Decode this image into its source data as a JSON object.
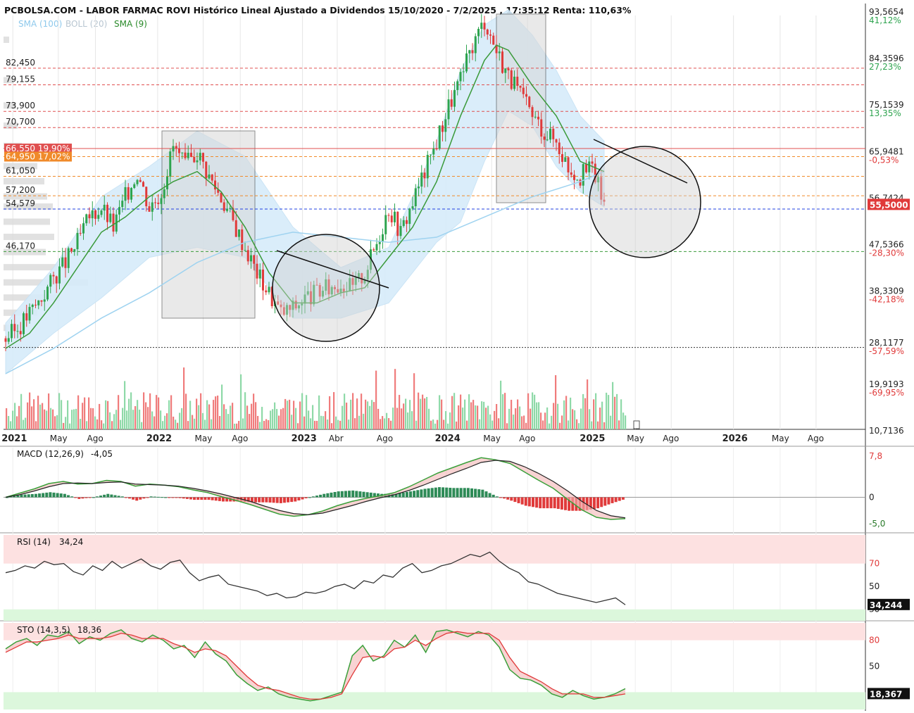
{
  "header": {
    "title": "PCBOLSA.COM - LABOR FARMAC ROVI Histórico Lineal Ajustado a Dividendos 15/10/2020 - 7/2/2025 , 17:35:12 Renta: 110,63%",
    "legend": [
      {
        "label": "SMA (100)",
        "color": "#9fd3f0"
      },
      {
        "label": "BOLL (20)",
        "color": "#cfd8df"
      },
      {
        "label": "SMA (9)",
        "color": "#2a8a2a"
      }
    ]
  },
  "colors": {
    "up": "#2ea44f",
    "down": "#e03a3a",
    "boll_fill": "#d6ecfa",
    "sma100": "#9fd3f0",
    "sma9": "#3a9a3a",
    "vol_up": "#8fd9a8",
    "vol_down": "#f07c7c"
  },
  "price_axis": {
    "ticks": [
      {
        "value": 93.5654,
        "label": "93,5654",
        "pct": "41,12%",
        "pct_color": "#2ea44f"
      },
      {
        "value": 84.3596,
        "label": "84,3596",
        "pct": "27,23%",
        "pct_color": "#2ea44f"
      },
      {
        "value": 75.1539,
        "label": "75,1539",
        "pct": "13,35%",
        "pct_color": "#2ea44f"
      },
      {
        "value": 65.9481,
        "label": "65,9481",
        "pct": "-0,53%",
        "pct_color": "#e03a3a"
      },
      {
        "value": 56.7424,
        "label": "56,7424",
        "pct": "",
        "pct_color": "#e03a3a"
      },
      {
        "value": 47.5366,
        "label": "47,5366",
        "pct": "-28,30%",
        "pct_color": "#e03a3a"
      },
      {
        "value": 38.3309,
        "label": "38,3309",
        "pct": "-42,18%",
        "pct_color": "#e03a3a"
      },
      {
        "value": 28.1177,
        "label": "28,1177",
        "pct": "-57,59%",
        "pct_color": "#e03a3a"
      },
      {
        "value": 19.9193,
        "label": "19,9193",
        "pct": "-69,95%",
        "pct_color": "#e03a3a"
      },
      {
        "value": 10.7136,
        "label": "10,7136",
        "pct": "",
        "pct_color": "#e03a3a"
      }
    ],
    "last_price": "55,5000"
  },
  "levels": [
    {
      "value": 82.45,
      "label": "82,450",
      "color": "#e05050",
      "style": "dash"
    },
    {
      "value": 79.155,
      "label": "79,155",
      "color": "#e05050",
      "style": "dash"
    },
    {
      "value": 73.9,
      "label": "73,900",
      "color": "#e05050",
      "style": "dash"
    },
    {
      "value": 70.7,
      "label": "70,700",
      "color": "#e05050",
      "style": "dash"
    },
    {
      "value": 66.55,
      "label": "66,550  19,90%",
      "color": "#e05050",
      "style": "solid",
      "boxed": true
    },
    {
      "value": 64.95,
      "label": "64,950  17,02%",
      "color": "#f08a2a",
      "style": "dash",
      "boxed": true
    },
    {
      "value": 61.05,
      "label": "61,050",
      "color": "#f08a2a",
      "style": "dash"
    },
    {
      "value": 57.2,
      "label": "57,200",
      "color": "#f08a2a",
      "style": "dash"
    },
    {
      "value": 54.579,
      "label": "54,579",
      "color": "#2040e0",
      "style": "dash"
    },
    {
      "value": 46.17,
      "label": "46,170",
      "color": "#3a9a3a",
      "style": "dash"
    }
  ],
  "x_axis": {
    "labels": [
      {
        "t": 0.6,
        "text": "2021",
        "year": true
      },
      {
        "t": 4.4,
        "text": "May",
        "year": false
      },
      {
        "t": 7.5,
        "text": "Ago",
        "year": false
      },
      {
        "t": 12.7,
        "text": "2022",
        "year": true
      },
      {
        "t": 16.5,
        "text": "May",
        "year": false
      },
      {
        "t": 19.6,
        "text": "Ago",
        "year": false
      },
      {
        "t": 24.8,
        "text": "2023",
        "year": true
      },
      {
        "t": 27.7,
        "text": "Abr",
        "year": false
      },
      {
        "t": 31.7,
        "text": "Ago",
        "year": false
      },
      {
        "t": 36.8,
        "text": "2024",
        "year": true
      },
      {
        "t": 40.6,
        "text": "May",
        "year": false
      },
      {
        "t": 43.6,
        "text": "Ago",
        "year": false
      },
      {
        "t": 48.9,
        "text": "2025",
        "year": true
      },
      {
        "t": 52.6,
        "text": "May",
        "year": false
      },
      {
        "t": 55.6,
        "text": "Ago",
        "year": false
      },
      {
        "t": 60.8,
        "text": "2026",
        "year": true
      },
      {
        "t": 64.7,
        "text": "May",
        "year": false
      },
      {
        "t": 67.7,
        "text": "Ago",
        "year": false
      }
    ]
  },
  "chart_data": [
    {
      "type": "line",
      "title": "PCBOLSA.COM - LABOR FARMAC ROVI Histórico Lineal Ajustado a Dividendos 15/10/2020 - 7/2/2025",
      "x_unit": "months since Oct 2020",
      "ylim": [
        10.7136,
        93.5654
      ],
      "series": [
        {
          "name": "price",
          "points": [
            [
              0,
              29
            ],
            [
              1,
              31
            ],
            [
              2,
              34
            ],
            [
              3,
              37
            ],
            [
              4,
              41
            ],
            [
              5,
              44
            ],
            [
              6,
              48
            ],
            [
              7,
              53
            ],
            [
              8,
              55
            ],
            [
              9,
              51
            ],
            [
              10,
              57
            ],
            [
              11,
              62
            ],
            [
              12,
              55
            ],
            [
              13,
              58
            ],
            [
              14,
              67
            ],
            [
              15,
              63
            ],
            [
              16,
              66
            ],
            [
              17,
              61
            ],
            [
              18,
              57
            ],
            [
              19,
              52
            ],
            [
              20,
              47
            ],
            [
              21,
              42
            ],
            [
              22,
              38
            ],
            [
              23,
              34
            ],
            [
              24,
              35
            ],
            [
              25,
              37
            ],
            [
              26,
              38
            ],
            [
              27,
              39
            ],
            [
              28,
              40
            ],
            [
              29,
              39
            ],
            [
              30,
              42
            ],
            [
              31,
              48
            ],
            [
              32,
              55
            ],
            [
              33,
              50
            ],
            [
              34,
              56
            ],
            [
              35,
              62
            ],
            [
              36,
              68
            ],
            [
              37,
              75
            ],
            [
              38,
              80
            ],
            [
              39,
              87
            ],
            [
              40,
              92
            ],
            [
              41,
              86
            ],
            [
              42,
              81
            ],
            [
              43,
              77
            ],
            [
              44,
              73
            ],
            [
              45,
              70
            ],
            [
              46,
              68
            ],
            [
              47,
              63
            ],
            [
              48,
              61
            ],
            [
              49,
              63
            ],
            [
              50,
              55.5
            ]
          ]
        },
        {
          "name": "SMA (9)",
          "points": [
            [
              0,
              27
            ],
            [
              2,
              30
            ],
            [
              4,
              36
            ],
            [
              6,
              43
            ],
            [
              8,
              50
            ],
            [
              10,
              53
            ],
            [
              12,
              57
            ],
            [
              14,
              60
            ],
            [
              16,
              62
            ],
            [
              18,
              58
            ],
            [
              20,
              51
            ],
            [
              22,
              42
            ],
            [
              24,
              36
            ],
            [
              26,
              36
            ],
            [
              28,
              38
            ],
            [
              30,
              39
            ],
            [
              32,
              45
            ],
            [
              34,
              51
            ],
            [
              36,
              60
            ],
            [
              38,
              73
            ],
            [
              40,
              84
            ],
            [
              41,
              87
            ],
            [
              42,
              86
            ],
            [
              44,
              79
            ],
            [
              46,
              73
            ],
            [
              48,
              64
            ],
            [
              50,
              62
            ]
          ]
        },
        {
          "name": "SMA (100)",
          "points": [
            [
              0,
              22
            ],
            [
              4,
              27
            ],
            [
              8,
              33
            ],
            [
              12,
              38
            ],
            [
              16,
              44
            ],
            [
              20,
              48
            ],
            [
              24,
              50
            ],
            [
              28,
              49
            ],
            [
              32,
              48
            ],
            [
              36,
              49
            ],
            [
              40,
              53
            ],
            [
              44,
              57
            ],
            [
              48,
              60
            ],
            [
              50,
              62
            ]
          ]
        },
        {
          "name": "BOLL upper",
          "points": [
            [
              0,
              32
            ],
            [
              4,
              43
            ],
            [
              8,
              57
            ],
            [
              12,
              63
            ],
            [
              16,
              70
            ],
            [
              20,
              65
            ],
            [
              24,
              51
            ],
            [
              28,
              43
            ],
            [
              32,
              47
            ],
            [
              34,
              57
            ],
            [
              36,
              68
            ],
            [
              38,
              82
            ],
            [
              40,
              91
            ],
            [
              42,
              94
            ],
            [
              44,
              89
            ],
            [
              46,
              82
            ],
            [
              48,
              73
            ],
            [
              50,
              68
            ]
          ]
        },
        {
          "name": "BOLL lower",
          "points": [
            [
              0,
              22
            ],
            [
              4,
              30
            ],
            [
              8,
              37
            ],
            [
              12,
              45
            ],
            [
              16,
              47
            ],
            [
              20,
              45
            ],
            [
              24,
              33
            ],
            [
              28,
              33
            ],
            [
              32,
              36
            ],
            [
              34,
              42
            ],
            [
              36,
              48
            ],
            [
              38,
              52
            ],
            [
              40,
              64
            ],
            [
              42,
              74
            ],
            [
              44,
              71
            ],
            [
              46,
              63
            ],
            [
              48,
              58
            ],
            [
              50,
              55
            ]
          ]
        }
      ]
    },
    {
      "type": "line",
      "title": "MACD (12,26,9)",
      "ylim": [
        -5.0,
        7.8
      ],
      "last": "-4,05",
      "ticks": [
        {
          "value": 7.8,
          "label": "7,8"
        },
        {
          "value": 0,
          "label": "0"
        },
        {
          "value": -5.0,
          "label": "-5,0"
        }
      ],
      "series": [
        {
          "name": "MACD",
          "values": [
            0,
            0.8,
            1.6,
            2.6,
            3.0,
            2.5,
            2.6,
            3.2,
            3.0,
            2.1,
            2.5,
            2.3,
            2.0,
            1.4,
            0.9,
            0.1,
            -0.6,
            -1.4,
            -2.3,
            -3.2,
            -3.6,
            -3.3,
            -2.6,
            -1.6,
            -0.8,
            -0.2,
            0.3,
            0.9,
            2.0,
            3.3,
            4.6,
            5.6,
            6.6,
            7.5,
            7.1,
            6.4,
            4.8,
            3.2,
            1.7,
            -0.4,
            -2.4,
            -3.8,
            -4.2,
            -4.05
          ]
        },
        {
          "name": "Signal",
          "values": [
            0,
            0.5,
            1.2,
            2.0,
            2.6,
            2.7,
            2.6,
            2.8,
            2.9,
            2.5,
            2.4,
            2.3,
            2.1,
            1.7,
            1.2,
            0.6,
            -0.1,
            -0.8,
            -1.7,
            -2.5,
            -3.1,
            -3.3,
            -3.0,
            -2.3,
            -1.6,
            -0.8,
            -0.1,
            0.5,
            1.3,
            2.3,
            3.4,
            4.5,
            5.5,
            6.6,
            7.0,
            6.8,
            5.8,
            4.5,
            3.0,
            1.2,
            -0.8,
            -2.5,
            -3.5,
            -3.9
          ]
        }
      ]
    },
    {
      "type": "line",
      "title": "RSI (14)",
      "ylim": [
        20,
        95
      ],
      "last": "34,24",
      "last_box": "34,244",
      "ticks": [
        {
          "value": 70,
          "label": "70"
        },
        {
          "value": 50,
          "label": "50"
        },
        {
          "value": 30,
          "label": "30"
        }
      ],
      "values": [
        62,
        64,
        68,
        66,
        72,
        69,
        70,
        63,
        60,
        68,
        64,
        72,
        66,
        70,
        74,
        68,
        65,
        71,
        73,
        62,
        55,
        58,
        60,
        52,
        50,
        48,
        46,
        42,
        44,
        40,
        41,
        45,
        44,
        46,
        50,
        52,
        48,
        55,
        53,
        60,
        58,
        66,
        70,
        62,
        64,
        68,
        70,
        74,
        78,
        76,
        80,
        72,
        66,
        62,
        54,
        52,
        48,
        44,
        42,
        40,
        38,
        36,
        38,
        40,
        34
      ]
    },
    {
      "type": "line",
      "title": "STO (14,3,5)",
      "ylim": [
        0,
        100
      ],
      "last": "18,36",
      "last_box": "18,367",
      "ticks": [
        {
          "value": 80,
          "label": "80"
        },
        {
          "value": 50,
          "label": "50"
        }
      ],
      "series": [
        {
          "name": "%K",
          "values": [
            70,
            78,
            82,
            74,
            86,
            84,
            90,
            76,
            84,
            80,
            88,
            92,
            82,
            78,
            86,
            80,
            70,
            74,
            60,
            78,
            64,
            56,
            40,
            30,
            22,
            26,
            18,
            14,
            12,
            10,
            12,
            16,
            20,
            62,
            74,
            56,
            62,
            80,
            72,
            86,
            66,
            90,
            92,
            88,
            84,
            90,
            86,
            72,
            46,
            36,
            34,
            28,
            18,
            14,
            22,
            16,
            12,
            14,
            18,
            24
          ]
        },
        {
          "name": "%D",
          "values": [
            66,
            72,
            78,
            78,
            80,
            82,
            86,
            82,
            82,
            82,
            84,
            88,
            86,
            82,
            82,
            82,
            76,
            72,
            66,
            70,
            68,
            62,
            50,
            38,
            28,
            24,
            22,
            18,
            14,
            12,
            12,
            14,
            18,
            40,
            60,
            62,
            60,
            70,
            72,
            80,
            74,
            82,
            88,
            90,
            88,
            88,
            88,
            80,
            60,
            44,
            38,
            32,
            24,
            18,
            18,
            18,
            14,
            14,
            16,
            18
          ]
        }
      ]
    }
  ]
}
